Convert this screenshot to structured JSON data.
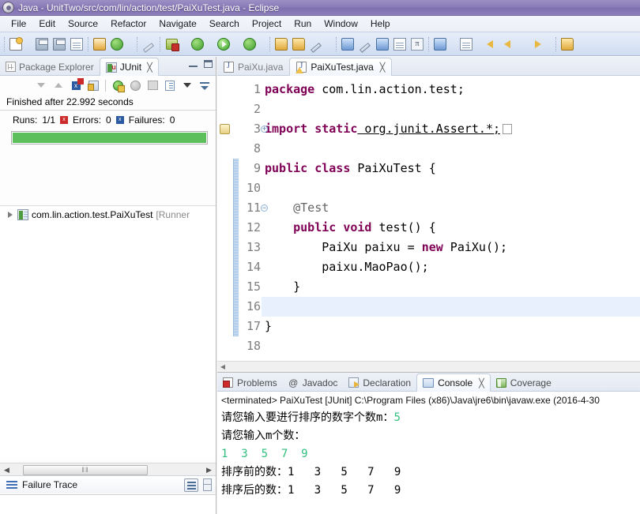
{
  "window": {
    "title": "Java - UnitTwo/src/com/lin/action/test/PaiXuTest.java - Eclipse",
    "icon": "eclipse-icon"
  },
  "menubar": {
    "items": [
      {
        "label": "File"
      },
      {
        "label": "Edit"
      },
      {
        "label": "Source"
      },
      {
        "label": "Refactor"
      },
      {
        "label": "Navigate"
      },
      {
        "label": "Search"
      },
      {
        "label": "Project"
      },
      {
        "label": "Run"
      },
      {
        "label": "Window"
      },
      {
        "label": "Help"
      }
    ]
  },
  "toolbar": {
    "groups": [
      {
        "buttons": [
          {
            "icon": "new-document-icon",
            "has_dropdown": true
          },
          {
            "icon": "save-icon",
            "has_dropdown": false
          },
          {
            "icon": "save-all-icon",
            "has_dropdown": false
          },
          {
            "icon": "print-icon",
            "has_dropdown": false
          }
        ]
      },
      {
        "buttons": [
          {
            "icon": "build-all-icon",
            "has_dropdown": false
          },
          {
            "icon": "refresh-icon",
            "has_dropdown": true
          }
        ]
      },
      {
        "buttons": [
          {
            "icon": "skip-breakpoints-icon",
            "has_dropdown": false
          }
        ]
      },
      {
        "buttons": [
          {
            "icon": "debug-icon",
            "has_dropdown": true
          },
          {
            "icon": "coverage-icon",
            "has_dropdown": true
          },
          {
            "icon": "run-icon",
            "has_dropdown": true
          },
          {
            "icon": "run-external-tools-icon",
            "has_dropdown": true
          }
        ]
      },
      {
        "buttons": [
          {
            "icon": "open-type-icon",
            "has_dropdown": false
          },
          {
            "icon": "new-java-project-icon",
            "has_dropdown": false
          },
          {
            "icon": "new-package-icon",
            "has_dropdown": true
          }
        ]
      },
      {
        "buttons": [
          {
            "icon": "search-icon",
            "has_dropdown": false
          },
          {
            "icon": "link-icon",
            "has_dropdown": false
          },
          {
            "icon": "toggle-mark-occurrences-icon",
            "has_dropdown": false
          },
          {
            "icon": "show-whitespace-icon",
            "has_dropdown": false
          },
          {
            "icon": "pi-icon",
            "has_dropdown": false
          }
        ]
      },
      {
        "buttons": [
          {
            "icon": "next-annotation-icon",
            "has_dropdown": true
          },
          {
            "icon": "previous-annotation-icon",
            "has_dropdown": true
          },
          {
            "icon": "back-icon",
            "has_dropdown": false
          },
          {
            "icon": "forward-icon",
            "has_dropdown": true
          },
          {
            "icon": "last-edit-icon",
            "has_dropdown": true
          }
        ]
      },
      {
        "buttons": [
          {
            "icon": "open-perspective-icon",
            "has_dropdown": false
          }
        ]
      }
    ]
  },
  "left_panel": {
    "tabs": [
      {
        "label": "Package Explorer",
        "icon": "package-explorer-icon",
        "active": false,
        "closable": false
      },
      {
        "label": "JUnit",
        "icon": "junit-icon",
        "active": true,
        "closable": true,
        "close_glyph": "╳"
      }
    ],
    "controls": [
      {
        "name": "minimize-view-button",
        "icon": "minimize-icon"
      },
      {
        "name": "maximize-view-button",
        "icon": "maximize-icon"
      }
    ],
    "junit_toolbar": [
      {
        "icon": "next-failure-icon"
      },
      {
        "icon": "previous-failure-icon"
      },
      {
        "icon": "show-failures-only-icon"
      },
      {
        "icon": "scroll-lock-icon"
      },
      {
        "icon": "rerun-test-icon"
      },
      {
        "icon": "rerun-failed-icon"
      },
      {
        "icon": "stop-icon"
      },
      {
        "icon": "test-run-history-icon"
      },
      {
        "icon": "view-menu-icon"
      },
      {
        "icon": "minimize-arrow-icon"
      }
    ],
    "status": "Finished after 22.992 seconds",
    "counters": {
      "runs_label": "Runs:",
      "runs_value": "1/1",
      "errors_label": "Errors:",
      "errors_value": "0",
      "failures_label": "Failures:",
      "failures_value": "0",
      "errors_badge": "x",
      "failures_badge": "x"
    },
    "progress": {
      "percent": 100,
      "color": "#5cbf5c"
    },
    "tree": [
      {
        "label": "com.lin.action.test.PaiXuTest",
        "suffix": "[Runner",
        "icon": "test-suite-icon",
        "expandable": true
      }
    ],
    "failure_trace": {
      "label": "Failure Trace",
      "icon": "failure-trace-icon",
      "buttons": [
        {
          "name": "filter-stack-trace-button",
          "icon": "filter-icon"
        },
        {
          "name": "view-menu-button",
          "icon": "view-menu-icon"
        }
      ]
    },
    "scrollbar": {
      "left_glyph": "◀",
      "right_glyph": "▶",
      "thumb_grip": "‖‖"
    }
  },
  "editor": {
    "tabs": [
      {
        "label": "PaiXu.java",
        "icon": "java-file-icon",
        "active": false,
        "warning": false
      },
      {
        "label": "PaiXuTest.java",
        "icon": "java-file-icon",
        "active": true,
        "warning": true,
        "close_glyph": "╳"
      }
    ],
    "lines": [
      {
        "num": "1",
        "fold": "",
        "segments": [
          {
            "t": "package",
            "c": "kw"
          },
          {
            "t": " com.lin.action.test;",
            "c": ""
          }
        ]
      },
      {
        "num": "2",
        "fold": "",
        "segments": []
      },
      {
        "num": "3",
        "fold": "+",
        "marker": "warning",
        "segments": [
          {
            "t": "import",
            "c": "kw"
          },
          {
            "t": " ",
            "c": ""
          },
          {
            "t": "static",
            "c": "kw"
          },
          {
            "t": " org.junit.Assert.*;",
            "c": "",
            "underline": true
          }
        ],
        "trailing_box": true
      },
      {
        "num": "8",
        "fold": "",
        "segments": []
      },
      {
        "num": "9",
        "fold": "",
        "changed": true,
        "segments": [
          {
            "t": "public",
            "c": "kw"
          },
          {
            "t": " ",
            "c": ""
          },
          {
            "t": "class",
            "c": "kw"
          },
          {
            "t": " PaiXuTest {",
            "c": ""
          }
        ]
      },
      {
        "num": "10",
        "fold": "",
        "changed": true,
        "segments": []
      },
      {
        "num": "11",
        "fold": "-",
        "changed": true,
        "segments": [
          {
            "t": "    @Test",
            "c": "ann"
          }
        ]
      },
      {
        "num": "12",
        "fold": "",
        "changed": true,
        "segments": [
          {
            "t": "    ",
            "c": ""
          },
          {
            "t": "public",
            "c": "kw"
          },
          {
            "t": " ",
            "c": ""
          },
          {
            "t": "void",
            "c": "kw"
          },
          {
            "t": " test() {",
            "c": ""
          }
        ]
      },
      {
        "num": "13",
        "fold": "",
        "changed": true,
        "segments": [
          {
            "t": "        PaiXu paixu = ",
            "c": ""
          },
          {
            "t": "new",
            "c": "kw"
          },
          {
            "t": " PaiXu();",
            "c": ""
          }
        ]
      },
      {
        "num": "14",
        "fold": "",
        "changed": true,
        "segments": [
          {
            "t": "        paixu.MaoPao();",
            "c": ""
          }
        ]
      },
      {
        "num": "15",
        "fold": "",
        "changed": true,
        "segments": [
          {
            "t": "    }",
            "c": ""
          }
        ]
      },
      {
        "num": "16",
        "fold": "",
        "changed": true,
        "current": true,
        "segments": []
      },
      {
        "num": "17",
        "fold": "",
        "changed": true,
        "segments": [
          {
            "t": "}",
            "c": ""
          }
        ]
      },
      {
        "num": "18",
        "fold": "",
        "segments": []
      }
    ]
  },
  "console": {
    "tabs": [
      {
        "label": "Problems",
        "icon": "problems-icon",
        "active": false
      },
      {
        "label": "Javadoc",
        "icon": "javadoc-icon",
        "active": false
      },
      {
        "label": "Declaration",
        "icon": "declaration-icon",
        "active": false
      },
      {
        "label": "Console",
        "icon": "console-icon",
        "active": true,
        "closable": true,
        "close_glyph": "╳"
      },
      {
        "label": "Coverage",
        "icon": "coverage-icon",
        "active": false
      }
    ],
    "header": "<terminated> PaiXuTest [JUnit] C:\\Program Files (x86)\\Java\\jre6\\bin\\javaw.exe (2016-4-30",
    "output_lines": [
      {
        "segments": [
          {
            "t": "请您输入要进行排序的数字个数m：",
            "style": "out"
          },
          {
            "t": "5",
            "style": "in"
          }
        ]
      },
      {
        "segments": [
          {
            "t": "请您输入m个数：",
            "style": "out"
          }
        ]
      },
      {
        "segments": [
          {
            "t": "1  3  5  7  9",
            "style": "in"
          }
        ]
      },
      {
        "segments": [
          {
            "t": "排序前的数：1   3   5   7   9",
            "style": "out"
          }
        ]
      },
      {
        "segments": [
          {
            "t": "排序后的数：1   3   5   7   9",
            "style": "out"
          }
        ]
      }
    ]
  },
  "colors": {
    "title_bar": "#8a7cb8",
    "accent_green": "#5cbf5c",
    "console_input": "#2ebf7d",
    "keyword": "#7f0055",
    "changed_bar": "#a7c7e8",
    "current_line": "#e8f0fe"
  }
}
